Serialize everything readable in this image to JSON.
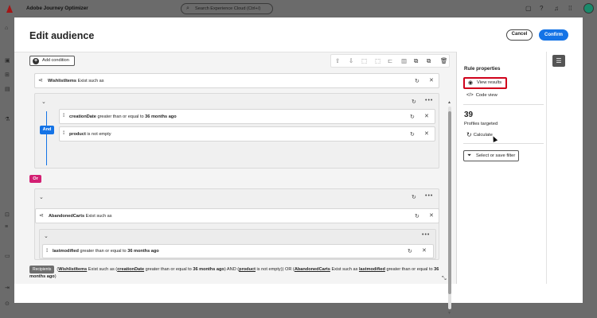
{
  "app": {
    "title": "Adobe Journey Optimizer",
    "search_placeholder": "Search Experience Cloud (Ctrl+/)"
  },
  "modal": {
    "title": "Edit audience",
    "cancel_label": "Cancel",
    "confirm_label": "Confirm",
    "add_condition_label": "Add condition"
  },
  "rules": {
    "wishlist": {
      "name": "WishlistItems",
      "op": "Exist such as"
    },
    "and_label": "And",
    "or_label": "Or",
    "cond1": {
      "field": "creationDate",
      "op": "greater than or equal to",
      "value": "36 months ago"
    },
    "cond2": {
      "field": "product",
      "op": "is not empty"
    },
    "abandoned": {
      "name": "AbandonedCarts",
      "op": "Exist such as"
    },
    "cond3": {
      "field": "lastmodified",
      "op": "greater than or equal to",
      "value": "36 months ago"
    }
  },
  "summary": {
    "tag": "Recipients",
    "p1": "(",
    "wishlist": "WishlistItems",
    "p2": " Exist such as (",
    "creation": "creationDate",
    "p3": " greater than or equal to ",
    "v1": "36 months ago",
    "p4": ") AND (",
    "product": "product",
    "p5": " is not empty)) OR (",
    "abandoned": "AbandonedCarts",
    "p6": " Exist such as ",
    "lastmod": "lastmodified",
    "p7": " greater than or equal to ",
    "v2": "36 months ago",
    "p8": ")"
  },
  "props": {
    "title": "Rule properties",
    "view_results": "View results",
    "code_view": "Code view",
    "count": "39",
    "count_label": "Profiles targeted",
    "calculate": "Calculate",
    "filter": "Select or save filter"
  },
  "colors": {
    "accent": "#1473e6",
    "or": "#d31f73",
    "highlight": "#d0021b"
  }
}
